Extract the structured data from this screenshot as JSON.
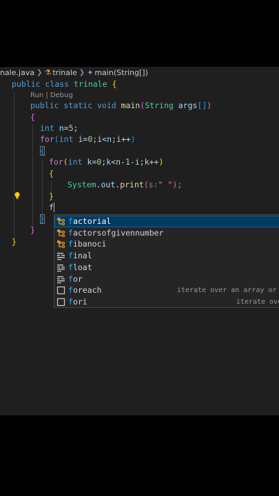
{
  "breadcrumb": {
    "file": "nale.java",
    "class": "trinale",
    "method": "main(String[])"
  },
  "codelens": "Run | Debug",
  "code": {
    "l1": [
      "public",
      " ",
      "class",
      " ",
      "trinale",
      " ",
      "{"
    ],
    "l2": [
      "public",
      " ",
      "static",
      " ",
      "void",
      " ",
      "main",
      "(",
      "String",
      " ",
      "args",
      "[]",
      ")"
    ],
    "l3": [
      "{"
    ],
    "l4": [
      "int",
      " ",
      "n",
      "=",
      "5",
      ";"
    ],
    "l5": [
      "for",
      "(",
      "int",
      " ",
      "i",
      "=",
      "0",
      ";",
      "i",
      "<",
      "n",
      ";",
      "i",
      "++",
      ")"
    ],
    "l6": [
      "{"
    ],
    "l7": [
      "for",
      "(",
      "int",
      " ",
      "k",
      "=",
      "0",
      ";",
      "k",
      "<",
      "n",
      "-",
      "1",
      "-",
      "i",
      ";",
      "k",
      "++",
      ")"
    ],
    "l8": [
      "{"
    ],
    "l9": [
      "System",
      ".",
      "out",
      ".",
      "print",
      "(",
      "s:",
      "\" \"",
      ");"
    ],
    "l10": [
      "}"
    ],
    "l11": [
      "f"
    ],
    "l12": [
      "}"
    ],
    "l13": [
      "}"
    ],
    "l14": [
      "}"
    ]
  },
  "suggestions": [
    {
      "match": "f",
      "rest": "actorial",
      "icon": "class-icon",
      "detail": "",
      "selected": true
    },
    {
      "match": "f",
      "rest": "actorsofgivennumber",
      "icon": "class-icon",
      "detail": "",
      "selected": false
    },
    {
      "match": "f",
      "rest": "ibanoci",
      "icon": "class-icon",
      "detail": "",
      "selected": false
    },
    {
      "match": "f",
      "rest": "inal",
      "icon": "keyword-icon",
      "detail": "",
      "selected": false
    },
    {
      "match": "f",
      "rest": "loat",
      "icon": "keyword-icon",
      "detail": "",
      "selected": false
    },
    {
      "match": "f",
      "rest": "or",
      "icon": "keyword-icon",
      "detail": "",
      "selected": false
    },
    {
      "match": "f",
      "rest": "oreach",
      "icon": "snippet-icon",
      "detail": "iterate over an array or I",
      "selected": false
    },
    {
      "match": "f",
      "rest": "ori",
      "icon": "snippet-icon",
      "detail": "iterate ove",
      "selected": false
    }
  ],
  "colors": {
    "editor_bg": "#1f1f1f",
    "keyword": "#569cd6",
    "type": "#4ec9b0",
    "function": "#dcdcaa",
    "variable": "#9cdcfe",
    "number": "#b5cea8",
    "string": "#ce9178",
    "selection": "#04395e",
    "match_highlight": "#2aaaff"
  }
}
